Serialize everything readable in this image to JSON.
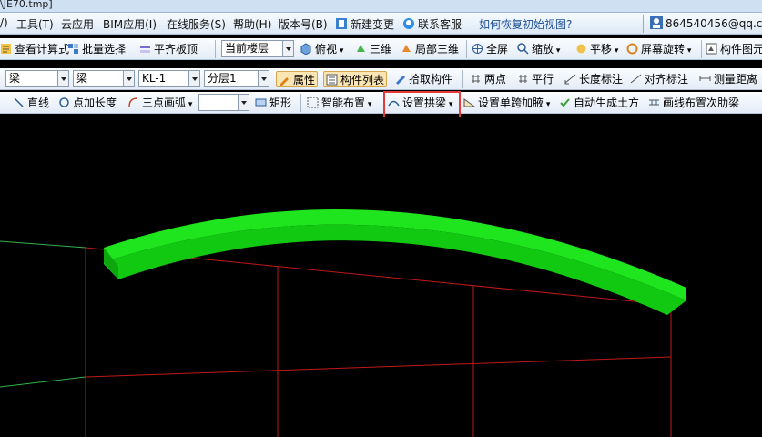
{
  "title_fragment": "\\JE70.tmp]",
  "menu": {
    "items": [
      "/)",
      "工具(T)",
      "云应用",
      "BIM应用(I)",
      "在线服务(S)",
      "帮助(H)",
      "版本号(B)"
    ],
    "new_change": "新建变更",
    "support": "联系客服",
    "help_link": "如何恢复初始视图?",
    "account": "864540456@qq.co"
  },
  "toolbar1": {
    "view_calc": "查看计算式",
    "batch_select": "批量选择",
    "flush_slab": "平齐板顶",
    "floor_select": "当前楼层",
    "top_view": "俯视",
    "view_3d": "三维",
    "partial_3d": "局部三维",
    "fullscreen": "全屏",
    "zoom": "缩放",
    "pan": "平移",
    "rotate_screen": "屏幕旋转",
    "component_figure": "构件图元"
  },
  "toolbar2": {
    "type1": "梁",
    "type2": "梁",
    "component": "KL-1",
    "layer": "分层1",
    "property": "属性",
    "component_list": "构件列表",
    "pick_component": "拾取构件",
    "two_points": "两点",
    "parallel": "平行",
    "length_dim": "长度标注",
    "align_dim": "对齐标注",
    "measure_dist": "测量距离"
  },
  "toolbar3": {
    "line": "直线",
    "point_length": "点加长度",
    "three_point_arc": "三点画弧",
    "rect": "矩形",
    "smart_layout": "智能布置",
    "set_arch_beam": "设置拱梁",
    "set_haunch": "设置单跨加腋",
    "auto_earthwork": "自动生成土方",
    "secondary_rib": "画线布置次肋梁"
  }
}
